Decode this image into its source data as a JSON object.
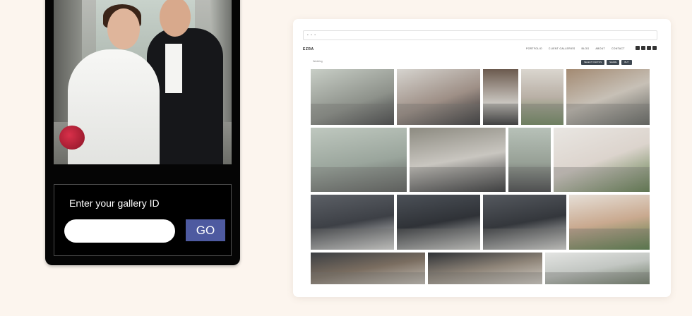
{
  "gallery_login": {
    "label": "Enter your gallery ID",
    "input_value": "",
    "input_placeholder": "",
    "go_label": "GO",
    "accent_color": "#4e5aa0"
  },
  "preview": {
    "url_dots": "• • •",
    "site_name": "EZRA",
    "nav": [
      "PORTFOLIO",
      "CLIENT GALLERIES",
      "BLOG",
      "ABOUT",
      "CONTACT"
    ],
    "social_icons": [
      "facebook-icon",
      "instagram-icon",
      "twitter-icon",
      "email-icon"
    ],
    "breadcrumb": "Wedding",
    "actions": [
      "SELECT PHOTOS",
      "SHARE",
      "BUY"
    ],
    "photos": [
      "couple-church-plaza",
      "couple-embrace-bouquet",
      "couple-doorway",
      "floral-arch-chair",
      "couple-street-tram",
      "couple-fountain-square",
      "couple-archway-kiss",
      "couple-townhouse",
      "floral-wall-decor",
      "couple-iron-gate",
      "couple-wooden-door",
      "couple-gate-kiss",
      "greenery-arch",
      "couple-vintage-car",
      "couple-car-window",
      "couple-balcony"
    ]
  }
}
